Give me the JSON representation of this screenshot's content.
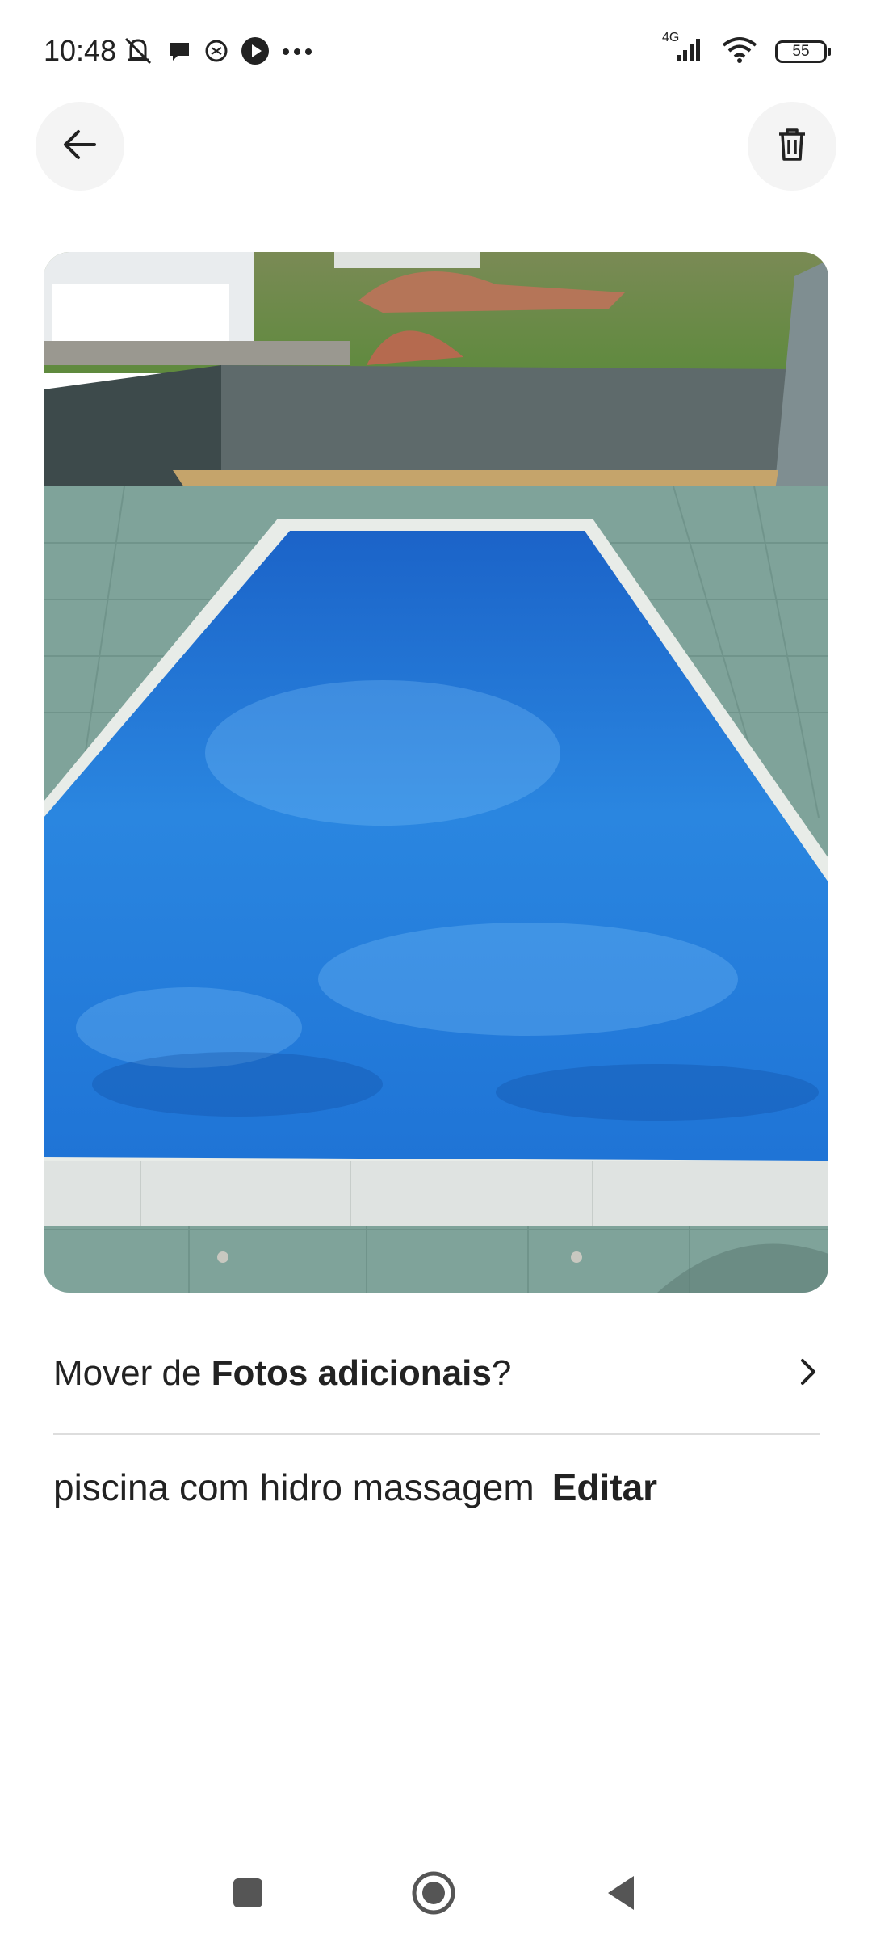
{
  "status_bar": {
    "time": "10:48",
    "network": "4G",
    "battery": "55",
    "left_icons": [
      "mute-bell-icon",
      "chat-bubble-icon",
      "app-icon",
      "play-icon",
      "more-dots-icon"
    ],
    "right_icons": [
      "cellular-signal-icon",
      "wifi-icon",
      "battery-icon"
    ]
  },
  "header": {
    "back_icon": "arrow-left-icon",
    "delete_icon": "trash-icon"
  },
  "photo": {
    "subject": "swimming pool photo"
  },
  "move_row": {
    "prefix": "Mover de ",
    "album": "Fotos adicionais",
    "suffix": "?",
    "icon": "chevron-right-icon"
  },
  "caption": {
    "text": "piscina com hidro massagem",
    "edit_label": "Editar"
  },
  "nav_bar": {
    "buttons": [
      "recents-square-icon",
      "home-circle-icon",
      "back-triangle-icon"
    ]
  },
  "colors": {
    "pool_blue": "#1f74d6",
    "deck_green": "#7fa39a",
    "text": "#222222",
    "divider": "#dddddd"
  }
}
